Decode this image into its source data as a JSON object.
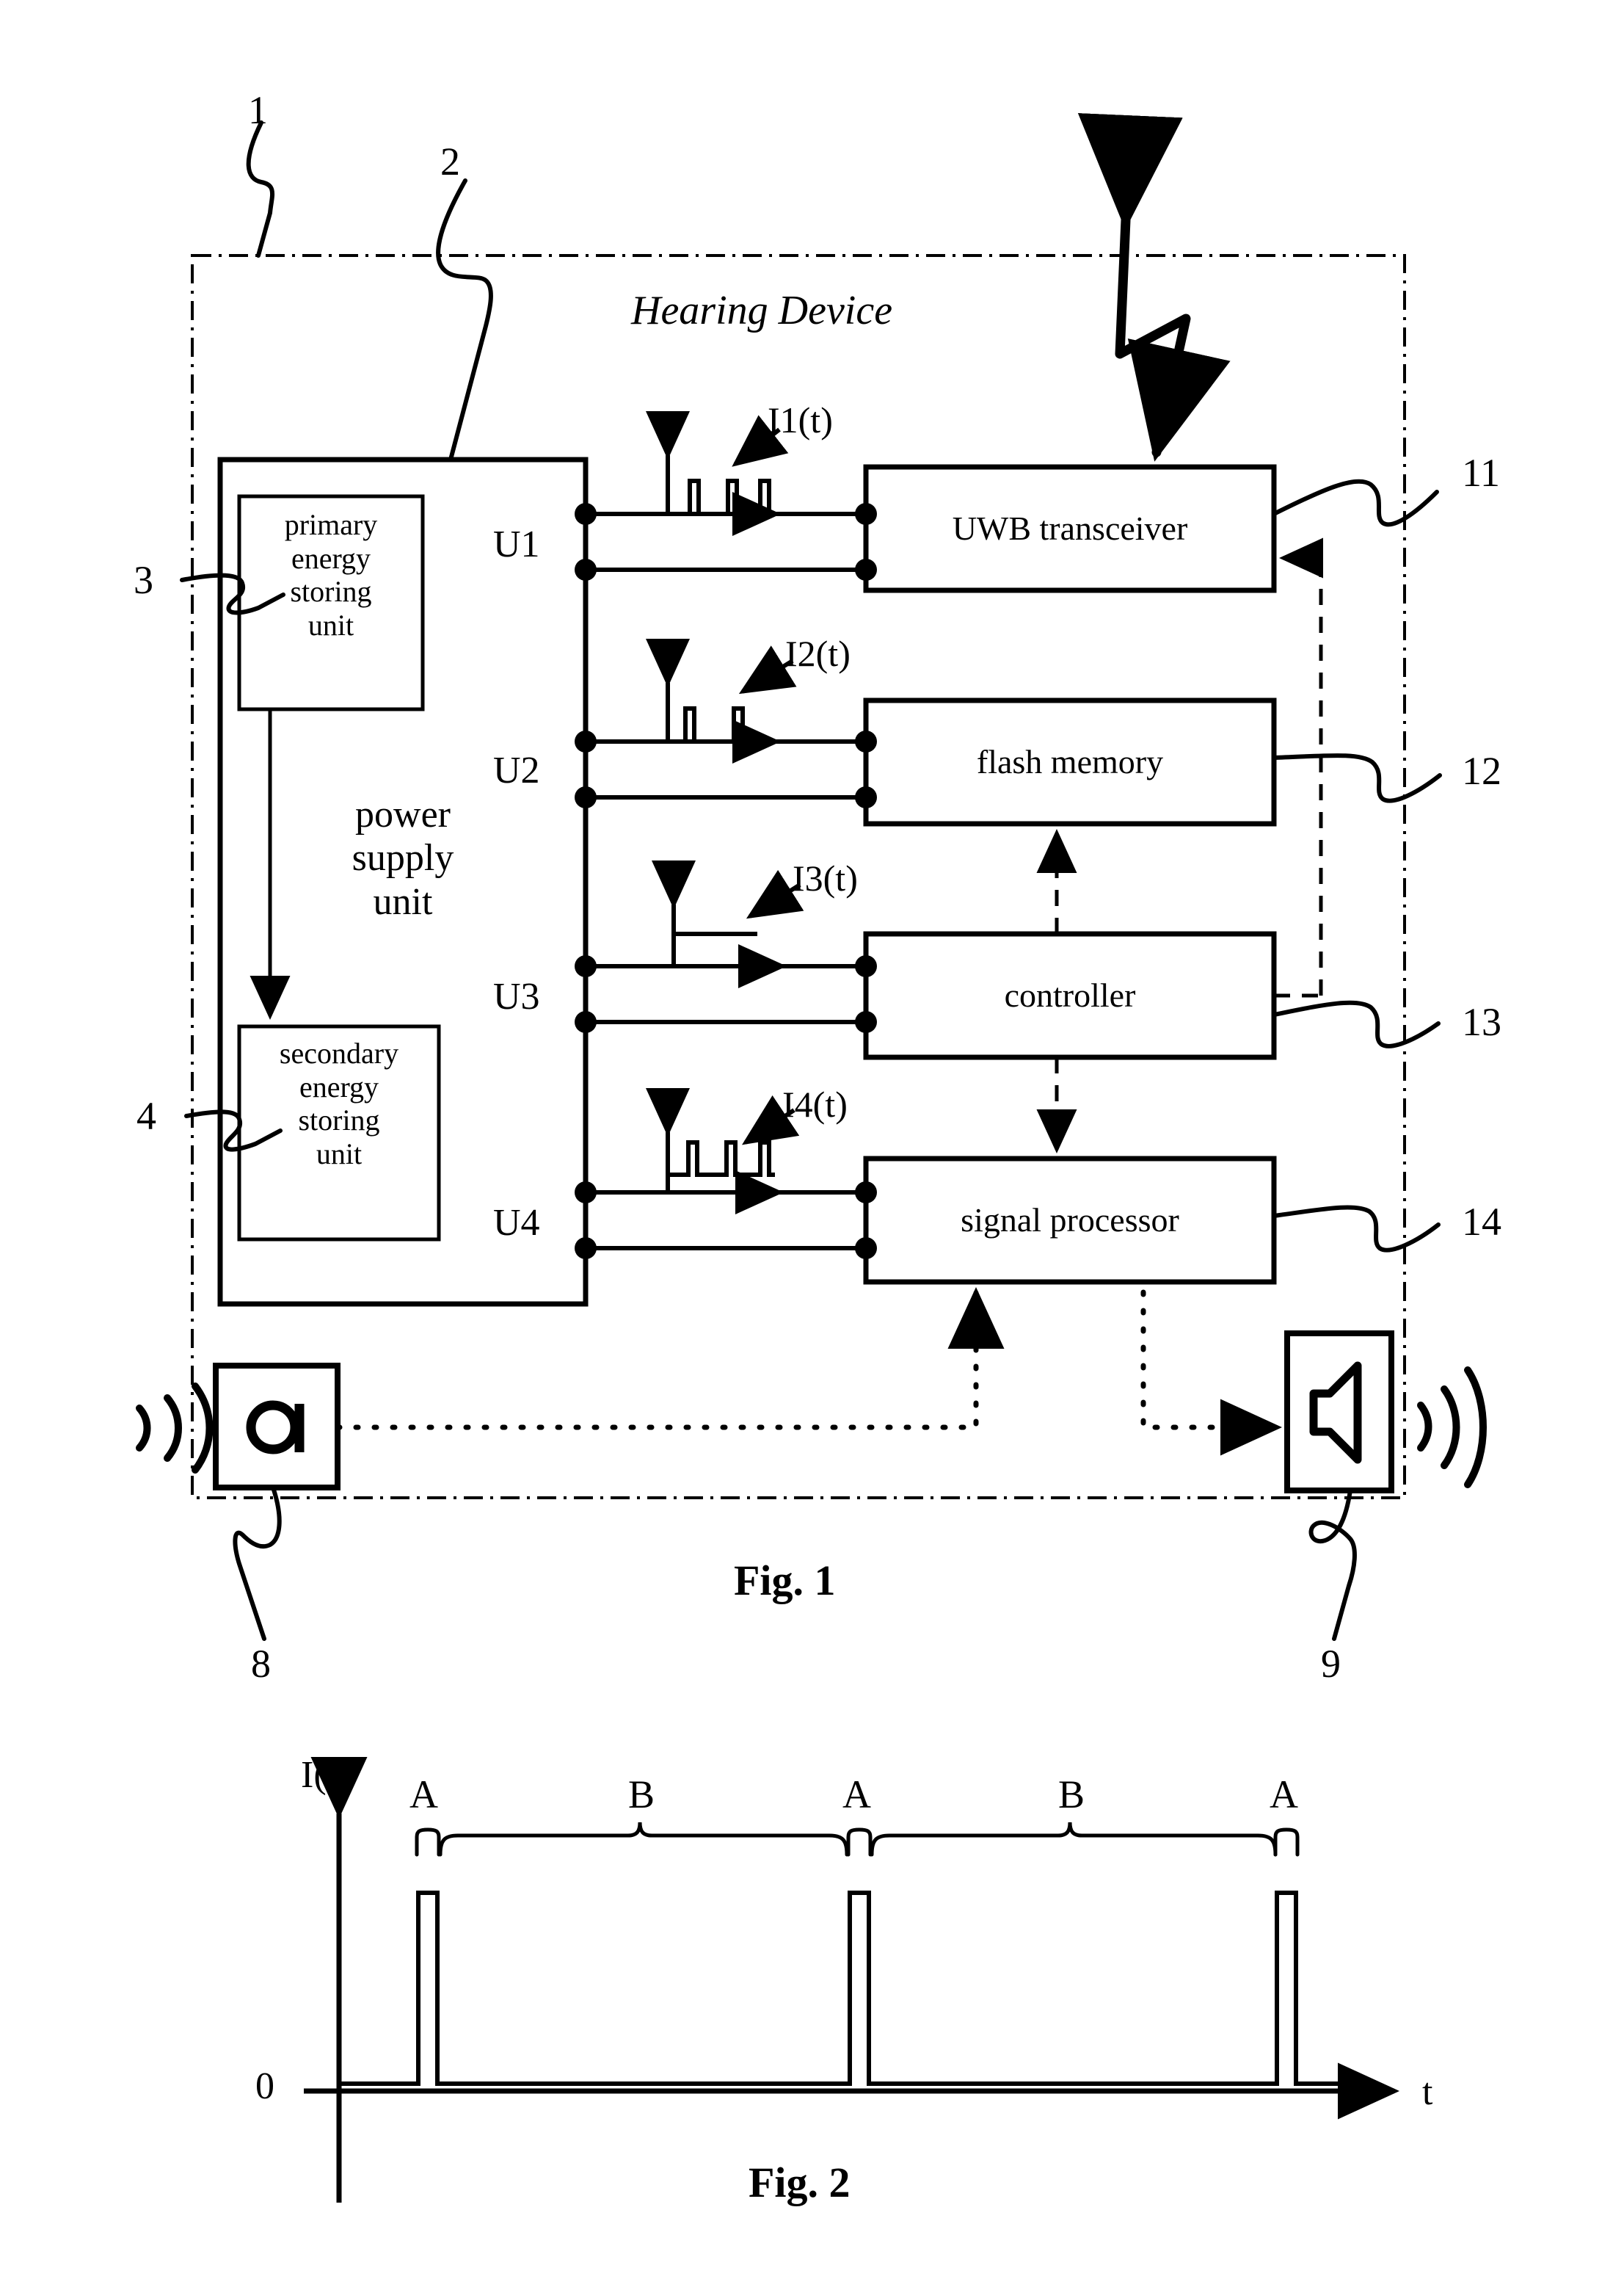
{
  "figure1": {
    "caption": "Fig. 1",
    "device_title": "Hearing Device",
    "device_ref": "1",
    "power_supply": {
      "ref": "2",
      "label": "power\nsupply\nunit",
      "primary": {
        "ref": "3",
        "label": "primary\nenergy\nstoring\nunit"
      },
      "secondary": {
        "ref": "4",
        "label": "secondary\nenergy\nstoring\nunit"
      }
    },
    "ports": [
      {
        "name": "U1",
        "signal": "I1(t)",
        "waveform": "pulses-3"
      },
      {
        "name": "U2",
        "signal": "I2(t)",
        "waveform": "pulses-2"
      },
      {
        "name": "U3",
        "signal": "I3(t)",
        "waveform": "constant"
      },
      {
        "name": "U4",
        "signal": "I4(t)",
        "waveform": "pulses-3-offset"
      }
    ],
    "blocks": [
      {
        "ref": "11",
        "label": "UWB transceiver"
      },
      {
        "ref": "12",
        "label": "flash memory"
      },
      {
        "ref": "13",
        "label": "controller"
      },
      {
        "ref": "14",
        "label": "signal processor"
      }
    ],
    "transducers": [
      {
        "ref": "8",
        "name": "microphone-icon"
      },
      {
        "ref": "9",
        "name": "speaker-icon"
      }
    ],
    "antenna": {
      "name": "lightning-bolt-icon"
    }
  },
  "figure2": {
    "caption": "Fig. 2",
    "ylabel": "I(t)",
    "xlabel": "t",
    "origin_label": "0",
    "interval_labels": [
      "A",
      "B",
      "A",
      "B",
      "A"
    ],
    "chart_data": {
      "type": "line",
      "title": "",
      "xlabel": "t",
      "ylabel": "I(t)",
      "x": [
        0,
        1.0,
        1.05,
        4.0,
        4.05,
        7.0,
        7.05,
        10
      ],
      "values": [
        0,
        0,
        1,
        0,
        1,
        0,
        1,
        0
      ],
      "pulse_positions": [
        1.0,
        4.0,
        7.0
      ],
      "pulse_height": 1,
      "baseline": 0,
      "intervals": [
        {
          "label": "A",
          "start": 1.0,
          "end": 1.08
        },
        {
          "label": "B",
          "start": 1.08,
          "end": 4.0
        },
        {
          "label": "A",
          "start": 4.0,
          "end": 4.08
        },
        {
          "label": "B",
          "start": 4.08,
          "end": 7.0
        },
        {
          "label": "A",
          "start": 7.0,
          "end": 7.08
        }
      ],
      "grid": false,
      "legend": "none",
      "xlim": [
        0,
        10
      ],
      "ylim": [
        0,
        1.25
      ]
    }
  }
}
